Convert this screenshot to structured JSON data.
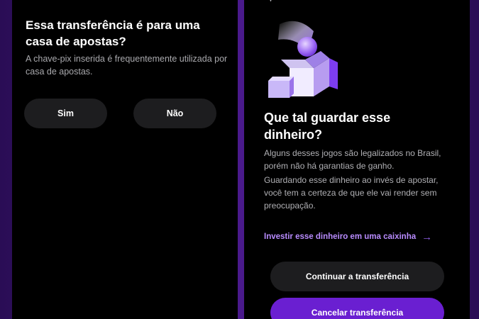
{
  "left_screen": {
    "title": "Essa transferência é para uma casa de apostas?",
    "subtitle": "A chave-pix inserida é frequentemente utilizada por casa de apostas.",
    "yes_label": "Sim",
    "no_label": "Não"
  },
  "right_screen": {
    "illustration": "gift-box-with-coin",
    "title": "Que tal guardar esse dinheiro?",
    "paragraph_1": "Alguns desses jogos são legalizados no Brasil, porém não há garantias de ganho.",
    "paragraph_2": "Guardando esse dinheiro ao invés de apostar, você tem a certeza de que ele vai render sem preocupação.",
    "invest_link": "Investir esse dinheiro em uma caixinha",
    "link_icon": "arrow-right-icon",
    "continue_label": "Continuar a transferência",
    "cancel_label": "Cancelar transferência"
  },
  "colors": {
    "background": "#000000",
    "frame": "#3a1670",
    "accent": "#6a1fd1",
    "link": "#b98cff",
    "button_dark": "#1d1d1f"
  }
}
